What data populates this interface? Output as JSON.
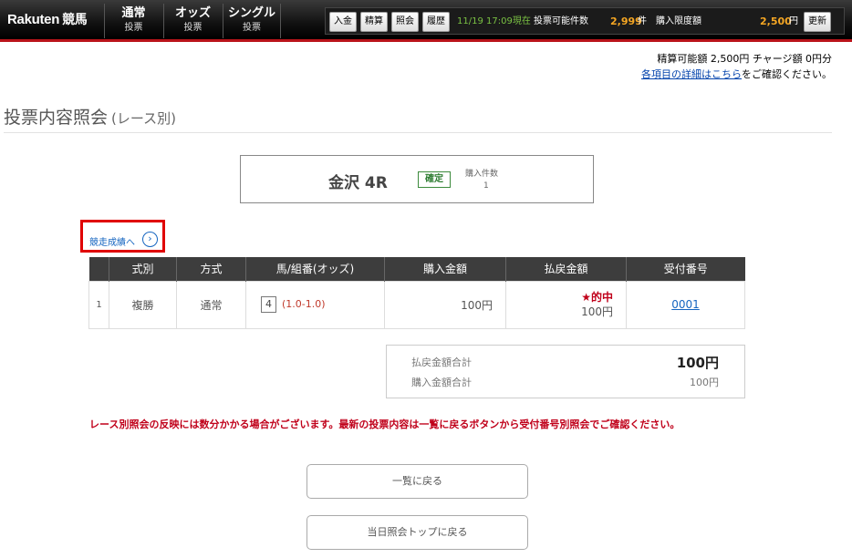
{
  "header": {
    "logo_main": "Rakuten",
    "logo_sub": "競馬",
    "nav": [
      {
        "title": "通常",
        "sub": "投票"
      },
      {
        "title": "オッズ",
        "sub": "投票"
      },
      {
        "title": "シングル",
        "sub": "投票"
      }
    ],
    "buttons": [
      "入金",
      "精算",
      "照会",
      "履歴"
    ],
    "timestamp": "11/19 17:09現在",
    "vote_count_label": "投票可能件数",
    "vote_count_value": "2,999",
    "vote_count_unit": "件",
    "limit_label": "購入限度額",
    "limit_value": "2,500",
    "limit_unit": "円",
    "refresh_label": "更新"
  },
  "balance": {
    "line1": "精算可能額 2,500円 チャージ額 0円分",
    "detail_link": "各項目の詳細はこちら",
    "detail_suffix": "をご確認ください。"
  },
  "page": {
    "title": "投票内容照会",
    "subtitle": "(レース別)"
  },
  "race": {
    "name": "金沢 4R",
    "status": "確定",
    "count_label": "購入件数",
    "count_value": "1"
  },
  "result_link": "競走成績へ",
  "table": {
    "headers": [
      "",
      "式別",
      "方式",
      "馬/組番(オッズ)",
      "購入金額",
      "払戻金額",
      "受付番号"
    ],
    "rows": [
      {
        "num": "1",
        "type": "複勝",
        "method": "通常",
        "horse": "4",
        "odds": "(1.0-1.0)",
        "amount": "100円",
        "hit": "★的中",
        "payout": "100円",
        "receipt": "0001"
      }
    ]
  },
  "summary": {
    "payout_label": "払戻金額合計",
    "payout_value": "100円",
    "purchase_label": "購入金額合計",
    "purchase_value": "100円"
  },
  "notice": "レース別照会の反映には数分かかる場合がございます。最新の投票内容は一覧に戻るボタンから受付番号別照会でご確認ください。",
  "buttons": {
    "back_list": "一覧に戻る",
    "back_top": "当日照会トップに戻る"
  },
  "colors": {
    "accent_red": "#c0001a",
    "header_bg": "#111111",
    "link_blue": "#1565c0",
    "orange": "#f5a623",
    "green": "#7ac143"
  }
}
